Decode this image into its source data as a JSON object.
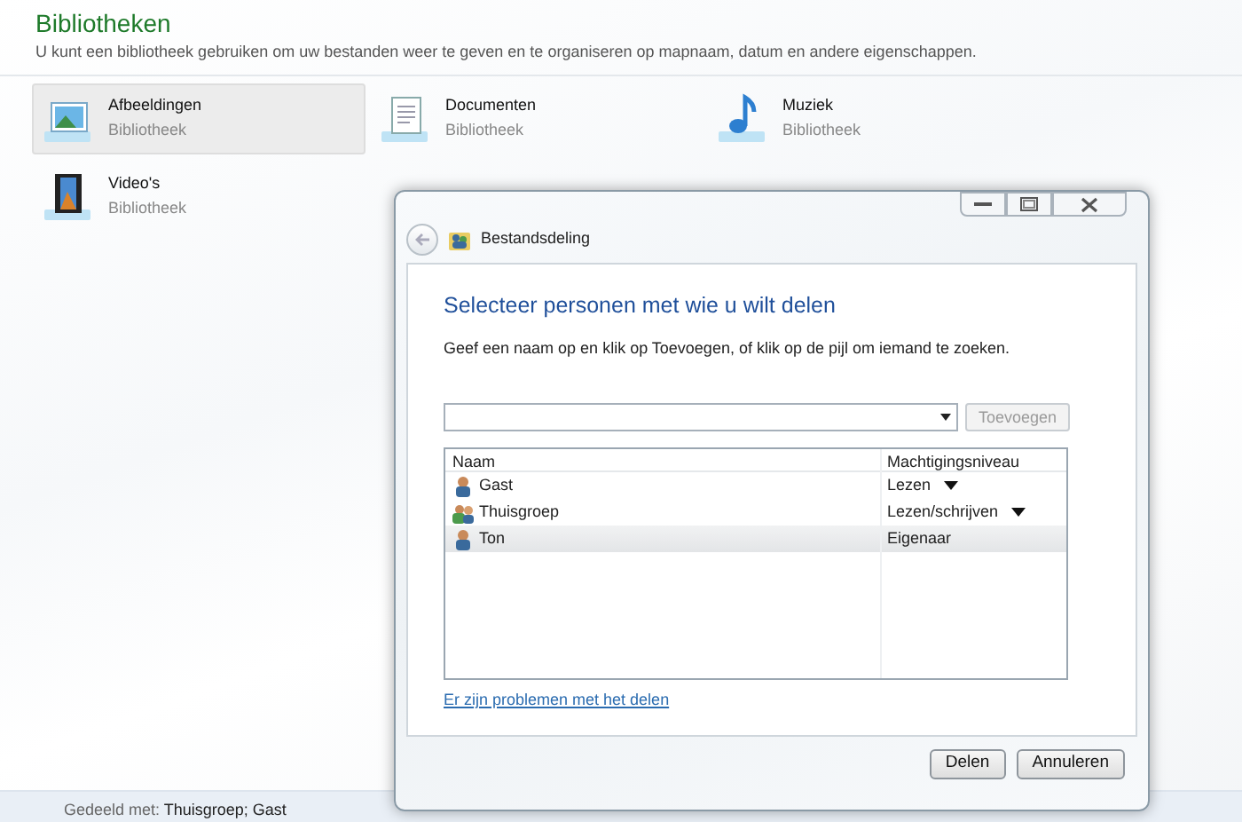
{
  "header": {
    "title": "Bibliotheken",
    "description": "U kunt een bibliotheek gebruiken om uw bestanden weer te geven en te organiseren op mapnaam, datum en andere eigenschappen."
  },
  "libraries": [
    {
      "name": "Afbeeldingen",
      "subtitle": "Bibliotheek",
      "kind": "pictures",
      "selected": true
    },
    {
      "name": "Documenten",
      "subtitle": "Bibliotheek",
      "kind": "documents",
      "selected": false
    },
    {
      "name": "Muziek",
      "subtitle": "Bibliotheek",
      "kind": "music",
      "selected": false
    },
    {
      "name": "Video's",
      "subtitle": "Bibliotheek",
      "kind": "videos",
      "selected": false
    }
  ],
  "dialog": {
    "nav_title": "Bestandsdeling",
    "heading": "Selecteer personen met wie u wilt delen",
    "instruction": "Geef een naam op en klik op Toevoegen, of klik op de pijl om iemand te zoeken.",
    "add_button": {
      "label": "Toevoegen",
      "disabled": true
    },
    "table": {
      "columns": [
        "Naam",
        "Machtigingsniveau"
      ],
      "rows": [
        {
          "name": "Gast",
          "permission": "Lezen",
          "kind": "user",
          "dropdown": true,
          "selected": false
        },
        {
          "name": "Thuisgroep",
          "permission": "Lezen/schrijven",
          "kind": "group",
          "dropdown": true,
          "selected": false
        },
        {
          "name": "Ton",
          "permission": "Eigenaar",
          "kind": "user",
          "dropdown": false,
          "selected": true
        }
      ]
    },
    "link": "Er zijn problemen met het delen",
    "buttons": [
      "Delen",
      "Annuleren"
    ]
  },
  "status_bar": {
    "label": "Gedeeld met:",
    "value": "Thuisgroep; Gast"
  }
}
